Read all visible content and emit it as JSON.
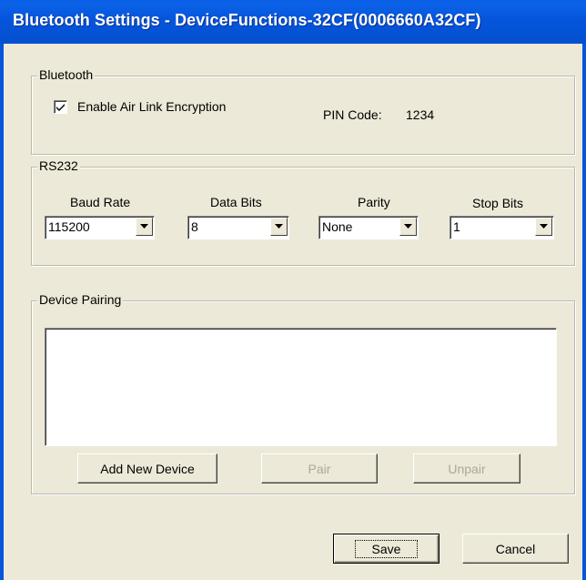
{
  "window": {
    "title": "Bluetooth Settings - DeviceFunctions-32CF(0006660A32CF)"
  },
  "bluetooth": {
    "legend": "Bluetooth",
    "encryption_label": "Enable Air Link Encryption",
    "encryption_checked": true,
    "pin_label": "PIN Code:",
    "pin_value": "1234"
  },
  "rs232": {
    "legend": "RS232",
    "baud_rate": {
      "label": "Baud Rate",
      "value": "115200"
    },
    "data_bits": {
      "label": "Data Bits",
      "value": "8"
    },
    "parity": {
      "label": "Parity",
      "value": "None"
    },
    "stop_bits": {
      "label": "Stop Bits",
      "value": "1"
    }
  },
  "pairing": {
    "legend": "Device Pairing",
    "devices": [],
    "add_label": "Add New Device",
    "pair_label": "Pair",
    "unpair_label": "Unpair"
  },
  "footer": {
    "save_label": "Save",
    "cancel_label": "Cancel"
  },
  "icons": {
    "checkmark": "checkmark-icon",
    "dropdown": "chevron-down-icon"
  },
  "colors": {
    "titlebar": "#0555dc",
    "dialog_bg": "#ece9d8",
    "disabled_text": "#aca899"
  }
}
